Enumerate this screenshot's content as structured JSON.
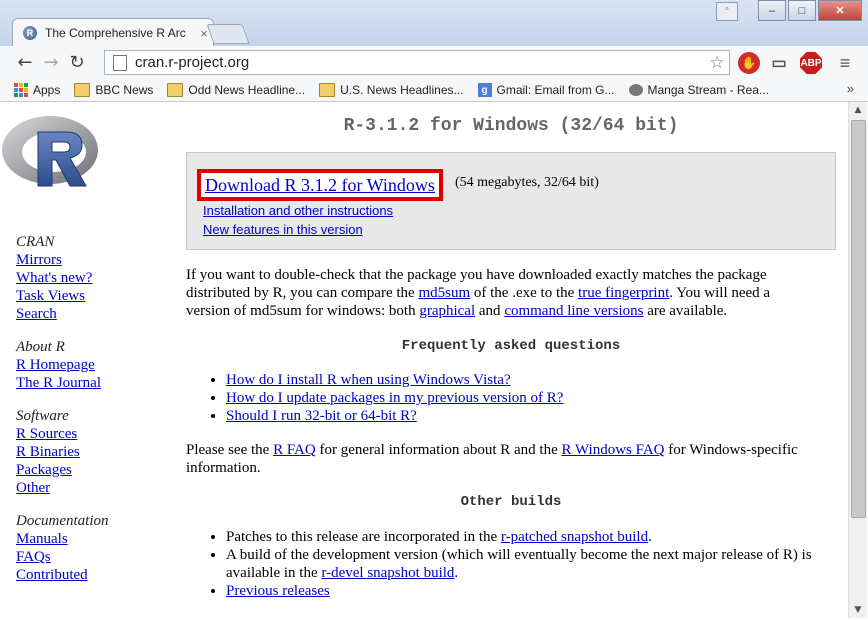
{
  "browser": {
    "tab_title": "The Comprehensive R Arc",
    "tab_close": "×",
    "url": "cran.r-project.org",
    "window_buttons": {
      "minimize": "–",
      "maximize": "□",
      "close": "✕"
    },
    "bookmarks": [
      {
        "label": "Apps",
        "icon": "apps-icon"
      },
      {
        "label": "BBC News",
        "icon": "folder-icon"
      },
      {
        "label": "Odd News Headline...",
        "icon": "folder-icon"
      },
      {
        "label": "U.S. News Headlines...",
        "icon": "folder-icon"
      },
      {
        "label": "Gmail: Email from G...",
        "icon": "google-icon"
      },
      {
        "label": "Manga Stream - Rea...",
        "icon": "manga-icon"
      }
    ],
    "bookmarks_more": "»",
    "ext_abp": "ABP",
    "google_letter": "g"
  },
  "sidebar": {
    "sections": [
      {
        "heading": "CRAN",
        "links": [
          "Mirrors",
          "What's new?",
          "Task Views",
          "Search"
        ]
      },
      {
        "heading": "About R",
        "links": [
          "R Homepage",
          "The R Journal"
        ]
      },
      {
        "heading": "Software",
        "links": [
          "R Sources",
          "R Binaries",
          "Packages",
          "Other"
        ]
      },
      {
        "heading": "Documentation",
        "links": [
          "Manuals",
          "FAQs",
          "Contributed"
        ]
      }
    ]
  },
  "content": {
    "title": "R-3.1.2 for Windows (32/64 bit)",
    "download": {
      "label": "Download R 3.1.2 for Windows",
      "size": "(54 megabytes, 32/64 bit)",
      "install_link": "Installation and other instructions",
      "features_link": "New features in this version"
    },
    "md5_para": {
      "t1": "If you want to double-check that the package you have downloaded exactly matches the package distributed by R, you can compare the ",
      "a1": "md5sum",
      "t2": " of the .exe to the ",
      "a2": "true fingerprint",
      "t3": ". You will need a version of md5sum for windows: both ",
      "a3": "graphical",
      "t4": " and ",
      "a4": "command line versions",
      "t5": " are available."
    },
    "faq_heading": "Frequently asked questions",
    "faq_items": [
      "How do I install R when using Windows Vista?",
      "How do I update packages in my previous version of R?",
      "Should I run 32-bit or 64-bit R?"
    ],
    "faq_para": {
      "t1": "Please see the ",
      "a1": "R FAQ",
      "t2": " for general information about R and the ",
      "a2": "R Windows FAQ",
      "t3": " for Windows-specific information."
    },
    "other_heading": "Other builds",
    "other_items": [
      {
        "t1": "Patches to this release are incorporated in the ",
        "a": "r-patched snapshot build",
        "t2": "."
      },
      {
        "t1": "A build of the development version (which will eventually become the next major release of R) is available in the ",
        "a": "r-devel snapshot build",
        "t2": "."
      },
      {
        "t1": "",
        "a": "Previous releases",
        "t2": ""
      }
    ]
  }
}
